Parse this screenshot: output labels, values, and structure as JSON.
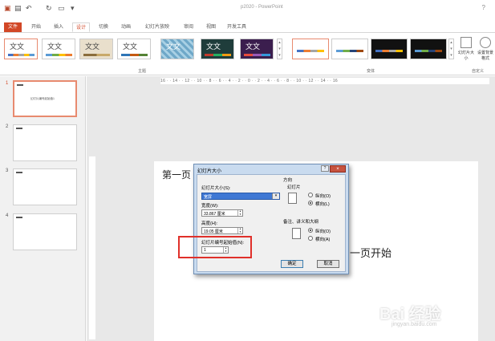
{
  "title_bar": {
    "document_title": "p2020 - PowerPoint",
    "quick_access": [
      "save-icon",
      "undo-icon",
      "redo-icon",
      "slideshow-icon",
      "customize-icon"
    ]
  },
  "tabs": [
    {
      "label": "文件",
      "kind": "file"
    },
    {
      "label": "开始"
    },
    {
      "label": "插入"
    },
    {
      "label": "设计",
      "active": true
    },
    {
      "label": "切换"
    },
    {
      "label": "动画"
    },
    {
      "label": "幻灯片放映"
    },
    {
      "label": "审阅"
    },
    {
      "label": "视图"
    },
    {
      "label": "开发工具"
    }
  ],
  "ribbon": {
    "themes_label": "主题",
    "variants_label": "变体",
    "customize_label": "自定义",
    "theme_text": "文文",
    "slide_size_label": "幻灯片大小",
    "format_bg_label": "设置背景格式"
  },
  "slides": {
    "numbers": [
      "1",
      "2",
      "3",
      "4"
    ],
    "thumb1_text": "幻灯片编号起始值1"
  },
  "ruler": {
    "horizontal": "16 · · 14 · · 12 · · 10 · · 8 · · 6 · · 4 · · 2 · · 0 · · 2 · · 4 · · 6 · · 8 · · 10 · · 12 · · 14 · · 16"
  },
  "slide": {
    "text1": "第一页",
    "text2": "一页开始"
  },
  "dialog": {
    "title": "幻灯片大小",
    "close_label": "×",
    "help_label": "?",
    "size_label": "幻灯片大小(S):",
    "size_value": "宽屏",
    "width_label": "宽度(W):",
    "width_value": "33.867 厘米",
    "height_label": "高度(H):",
    "height_value": "19.05 厘米",
    "start_label": "幻灯片编号起始值(N):",
    "start_value": "1",
    "orientation_label": "方向",
    "slides_label": "幻灯片",
    "portrait_label": "纵向(O)",
    "landscape_label": "横向(L)",
    "notes_label": "备注、讲义和大纲",
    "notes_portrait_label": "纵向(O)",
    "notes_landscape_label": "横向(A)",
    "ok_label": "确定",
    "cancel_label": "取消"
  },
  "watermark": {
    "text": "Bai 经验",
    "url": "jingyan.baidu.com"
  },
  "colors": {
    "accent": "#d24726",
    "highlight": "#e0302a"
  }
}
